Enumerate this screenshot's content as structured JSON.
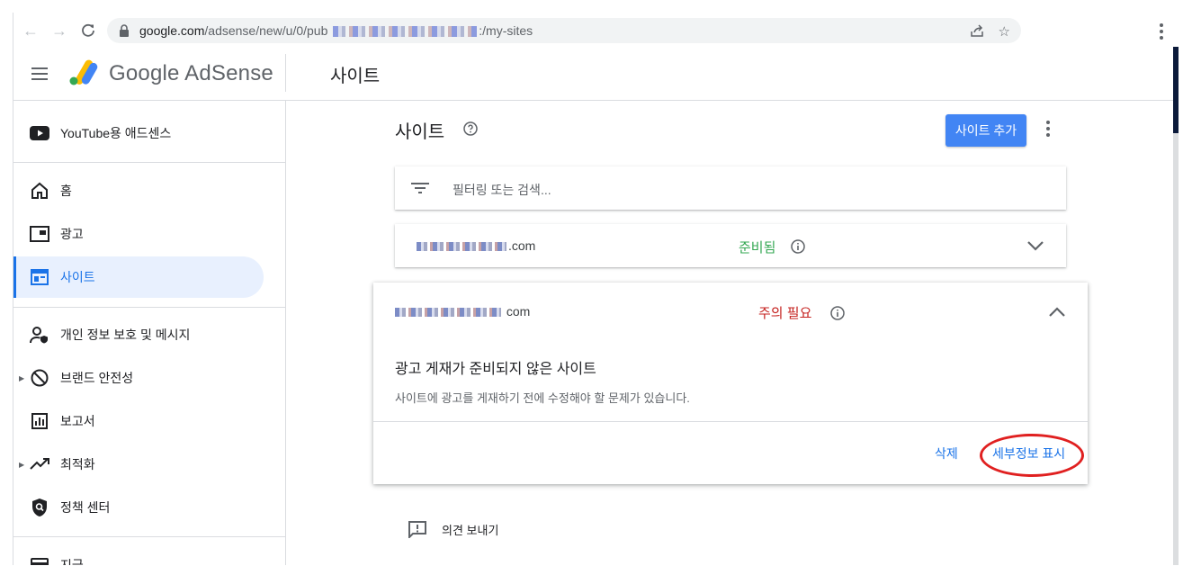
{
  "browser": {
    "url_domain": "google.com",
    "url_path": "/adsense/new/u/0/pub",
    "url_suffix": ":/my-sites"
  },
  "header": {
    "brand": "Google AdSense",
    "page_title": "사이트"
  },
  "sidebar": {
    "items": [
      {
        "label": "YouTube용 애드센스",
        "icon": "youtube-icon"
      },
      {
        "label": "홈",
        "icon": "home-icon"
      },
      {
        "label": "광고",
        "icon": "ads-icon"
      },
      {
        "label": "사이트",
        "icon": "sites-icon",
        "active": true
      },
      {
        "label": "개인 정보 보호 및 메시지",
        "icon": "privacy-icon"
      },
      {
        "label": "브랜드 안전성",
        "icon": "block-icon"
      },
      {
        "label": "보고서",
        "icon": "reports-icon"
      },
      {
        "label": "최적화",
        "icon": "trending-icon"
      },
      {
        "label": "정책 센터",
        "icon": "policy-shield-icon"
      },
      {
        "label": "지급",
        "icon": "payments-icon"
      }
    ]
  },
  "main": {
    "title": "사이트",
    "add_button": "사이트 추가",
    "filter_placeholder": "필터링 또는 검색...",
    "sites": [
      {
        "name_suffix": ".com",
        "status": "준비됨",
        "status_color": "#34a853"
      },
      {
        "name_suffix": "com",
        "status": "주의 필요",
        "status_color": "#c5221f",
        "expanded": {
          "title": "광고 게재가 준비되지 않은 사이트",
          "description": "사이트에 광고를 게재하기 전에 수정해야 할 문제가 있습니다.",
          "delete_label": "삭제",
          "details_label": "세부정보 표시"
        }
      }
    ],
    "feedback": "의견 보내기"
  },
  "colors": {
    "accent": "#1a73e8",
    "button": "#4285f4",
    "annotation": "#e02020"
  }
}
